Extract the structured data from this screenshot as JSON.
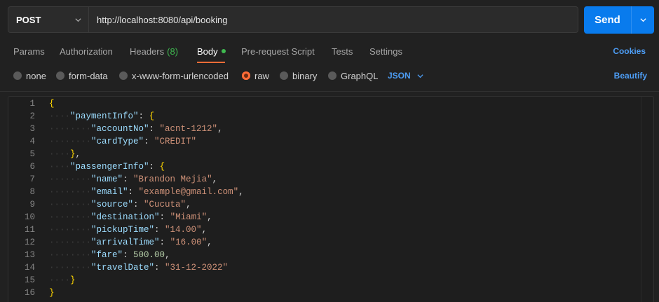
{
  "request": {
    "method": "POST",
    "url": "http://localhost:8080/api/booking",
    "send_label": "Send"
  },
  "tabs": [
    {
      "label": "Params"
    },
    {
      "label": "Authorization"
    },
    {
      "label": "Headers",
      "count": "(8)"
    },
    {
      "label": "Body",
      "active": true
    },
    {
      "label": "Pre-request Script"
    },
    {
      "label": "Tests"
    },
    {
      "label": "Settings"
    }
  ],
  "cookies_label": "Cookies",
  "body_types": [
    {
      "label": "none"
    },
    {
      "label": "form-data"
    },
    {
      "label": "x-www-form-urlencoded"
    },
    {
      "label": "raw",
      "selected": true
    },
    {
      "label": "binary"
    },
    {
      "label": "GraphQL"
    }
  ],
  "format": "JSON",
  "beautify_label": "Beautify",
  "code_lines": [
    {
      "n": "1",
      "indent": 0,
      "tokens": [
        {
          "t": "{",
          "c": "brace"
        }
      ]
    },
    {
      "n": "2",
      "indent": 1,
      "tokens": [
        {
          "t": "\"paymentInfo\"",
          "c": "key"
        },
        {
          "t": ": ",
          "c": "punc"
        },
        {
          "t": "{",
          "c": "brace"
        }
      ]
    },
    {
      "n": "3",
      "indent": 2,
      "tokens": [
        {
          "t": "\"accountNo\"",
          "c": "key"
        },
        {
          "t": ": ",
          "c": "punc"
        },
        {
          "t": "\"acnt-1212\"",
          "c": "str"
        },
        {
          "t": ",",
          "c": "punc"
        }
      ]
    },
    {
      "n": "4",
      "indent": 2,
      "tokens": [
        {
          "t": "\"cardType\"",
          "c": "key"
        },
        {
          "t": ": ",
          "c": "punc"
        },
        {
          "t": "\"CREDIT\"",
          "c": "str"
        }
      ]
    },
    {
      "n": "5",
      "indent": 1,
      "tokens": [
        {
          "t": "}",
          "c": "brace"
        },
        {
          "t": ",",
          "c": "punc"
        }
      ]
    },
    {
      "n": "6",
      "indent": 1,
      "tokens": [
        {
          "t": "\"passengerInfo\"",
          "c": "key"
        },
        {
          "t": ": ",
          "c": "punc"
        },
        {
          "t": "{",
          "c": "brace"
        }
      ]
    },
    {
      "n": "7",
      "indent": 2,
      "tokens": [
        {
          "t": "\"name\"",
          "c": "key"
        },
        {
          "t": ": ",
          "c": "punc"
        },
        {
          "t": "\"Brandon Mejia\"",
          "c": "str"
        },
        {
          "t": ",",
          "c": "punc"
        }
      ]
    },
    {
      "n": "8",
      "indent": 2,
      "tokens": [
        {
          "t": "\"email\"",
          "c": "key"
        },
        {
          "t": ": ",
          "c": "punc"
        },
        {
          "t": "\"example@gmail.com\"",
          "c": "str"
        },
        {
          "t": ",",
          "c": "punc"
        }
      ]
    },
    {
      "n": "9",
      "indent": 2,
      "tokens": [
        {
          "t": "\"source\"",
          "c": "key"
        },
        {
          "t": ": ",
          "c": "punc"
        },
        {
          "t": "\"Cucuta\"",
          "c": "str"
        },
        {
          "t": ",",
          "c": "punc"
        }
      ]
    },
    {
      "n": "10",
      "indent": 2,
      "tokens": [
        {
          "t": "\"destination\"",
          "c": "key"
        },
        {
          "t": ": ",
          "c": "punc"
        },
        {
          "t": "\"Miami\"",
          "c": "str"
        },
        {
          "t": ",",
          "c": "punc"
        }
      ]
    },
    {
      "n": "11",
      "indent": 2,
      "tokens": [
        {
          "t": "\"pickupTime\"",
          "c": "key"
        },
        {
          "t": ": ",
          "c": "punc"
        },
        {
          "t": "\"14.00\"",
          "c": "str"
        },
        {
          "t": ",",
          "c": "punc"
        }
      ]
    },
    {
      "n": "12",
      "indent": 2,
      "tokens": [
        {
          "t": "\"arrivalTime\"",
          "c": "key"
        },
        {
          "t": ": ",
          "c": "punc"
        },
        {
          "t": "\"16.00\"",
          "c": "str"
        },
        {
          "t": ",",
          "c": "punc"
        }
      ]
    },
    {
      "n": "13",
      "indent": 2,
      "tokens": [
        {
          "t": "\"fare\"",
          "c": "key"
        },
        {
          "t": ": ",
          "c": "punc"
        },
        {
          "t": "500.00",
          "c": "num"
        },
        {
          "t": ",",
          "c": "punc"
        }
      ]
    },
    {
      "n": "14",
      "indent": 2,
      "tokens": [
        {
          "t": "\"travelDate\"",
          "c": "key"
        },
        {
          "t": ": ",
          "c": "punc"
        },
        {
          "t": "\"31-12-2022\"",
          "c": "str"
        }
      ]
    },
    {
      "n": "15",
      "indent": 1,
      "tokens": [
        {
          "t": "}",
          "c": "brace"
        }
      ]
    },
    {
      "n": "16",
      "indent": 0,
      "tokens": [
        {
          "t": "}",
          "c": "brace"
        }
      ]
    }
  ],
  "colors": {
    "accent_send": "#097bed",
    "active_tab_underline": "#ff6c37",
    "link_blue": "#4d9df5",
    "status_green": "#3fb950"
  }
}
